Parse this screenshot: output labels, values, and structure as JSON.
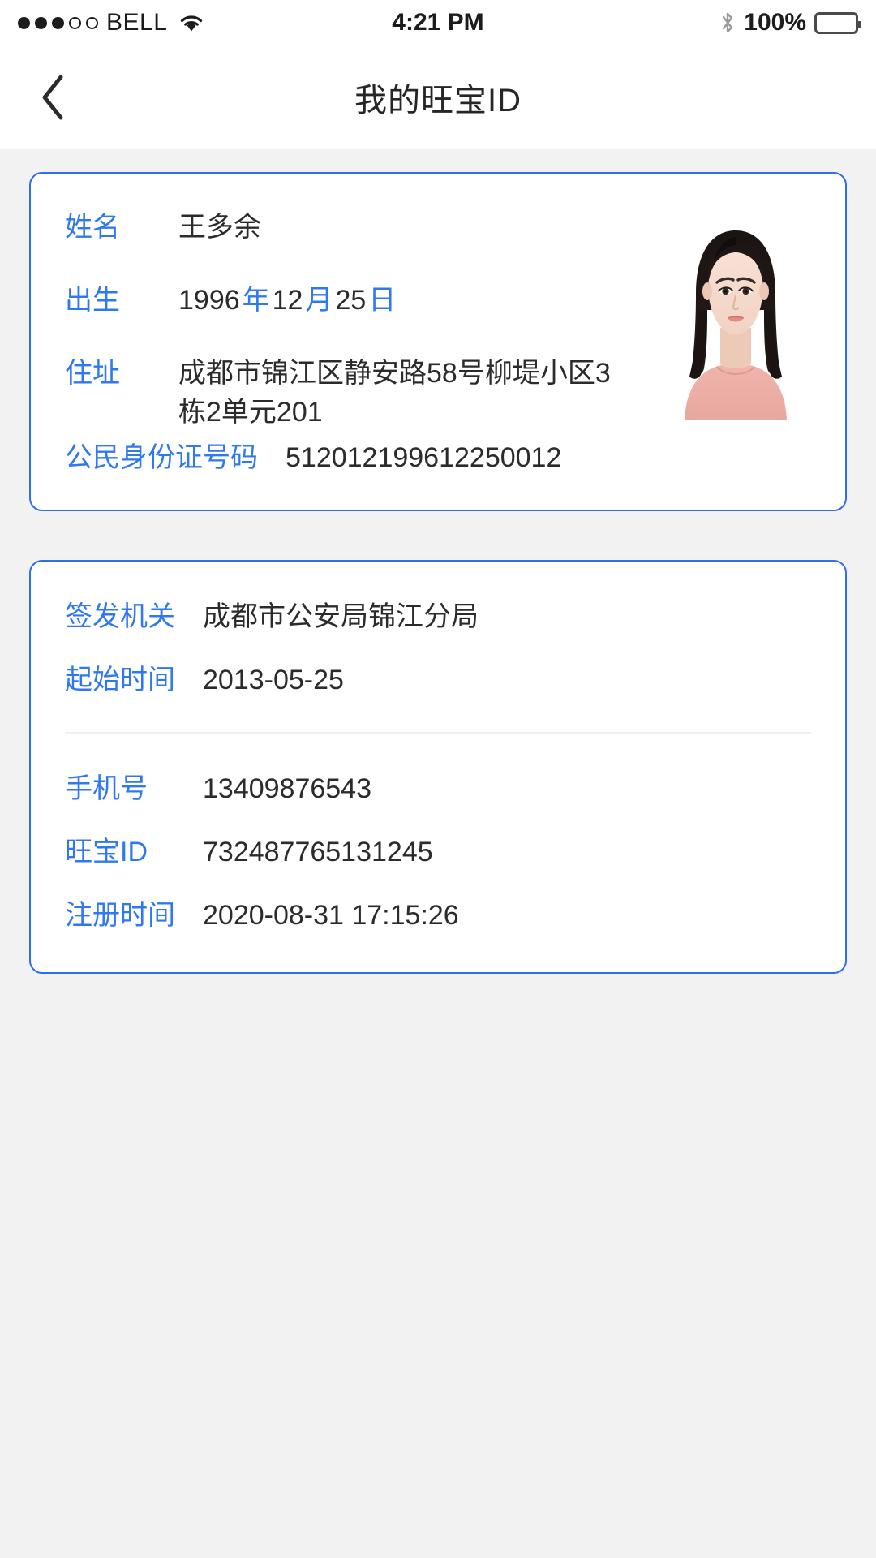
{
  "status_bar": {
    "signal_dots_total": 5,
    "signal_dots_filled": 3,
    "carrier": "BELL",
    "wifi_icon": "wifi-icon",
    "time": "4:21 PM",
    "bluetooth_icon": "bluetooth-icon",
    "battery_percent": "100%",
    "battery_icon": "battery-full-icon"
  },
  "header": {
    "back_icon": "back-chevron-icon",
    "title": "我的旺宝ID"
  },
  "identity_card": {
    "name": {
      "label": "姓名",
      "value": "王多余"
    },
    "birth": {
      "label": "出生",
      "year": "1996",
      "year_unit": "年",
      "month": "12",
      "month_unit": "月",
      "day": "25",
      "day_unit": "日"
    },
    "address": {
      "label": "住址",
      "value": "成都市锦江区静安路58号柳堤小区3栋2单元201"
    },
    "id_number": {
      "label": "公民身份证号码",
      "value": "512012199612250012"
    },
    "photo_alt": "id-portrait-photo"
  },
  "account_card": {
    "issuing_authority": {
      "label": "签发机关",
      "value": "成都市公安局锦江分局"
    },
    "start_date": {
      "label": "起始时间",
      "value": "2013-05-25"
    },
    "phone": {
      "label": "手机号",
      "value": "13409876543"
    },
    "wangbao_id": {
      "label": "旺宝ID",
      "value": "732487765131245"
    },
    "register_time": {
      "label": "注册时间",
      "value": "2020-08-31 17:15:26"
    }
  },
  "colors": {
    "accent": "#2f78f2",
    "card_border": "#2f6fed",
    "page_background": "#f2f2f2",
    "text": "#2b2b2b"
  }
}
